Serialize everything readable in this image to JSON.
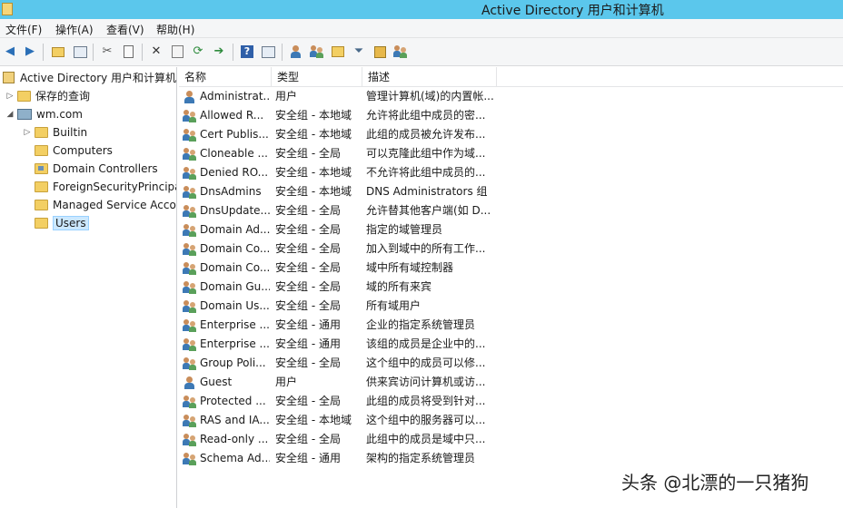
{
  "window": {
    "title": "Active Directory 用户和计算机"
  },
  "menu": [
    "文件(F)",
    "操作(A)",
    "查看(V)",
    "帮助(H)"
  ],
  "toolbar": {
    "icons": [
      "back-arrow-icon",
      "forward-arrow-icon",
      "up-folder-icon",
      "show-tree-icon",
      "cut-icon",
      "copy-icon",
      "delete-icon",
      "properties-icon",
      "refresh-icon",
      "export-list-icon",
      "help-icon",
      "console-icon",
      "new-user-icon",
      "new-group-icon",
      "new-ou-icon",
      "filter-icon",
      "find-icon",
      "add-to-group-icon"
    ]
  },
  "tree": {
    "root": "Active Directory 用户和计算机",
    "saved_queries": "保存的查询",
    "domain": "wm.com",
    "containers": [
      "Builtin",
      "Computers",
      "Domain Controllers",
      "ForeignSecurityPrincipals",
      "Managed Service Accounts",
      "Users"
    ],
    "selected": "Users"
  },
  "list": {
    "columns": {
      "name": "名称",
      "type": "类型",
      "desc": "描述"
    },
    "rows": [
      {
        "name": "Administrat...",
        "type": "用户",
        "desc": "管理计算机(域)的内置帐...",
        "kind": "user"
      },
      {
        "name": "Allowed R...",
        "type": "安全组 - 本地域",
        "desc": "允许将此组中成员的密...",
        "kind": "group"
      },
      {
        "name": "Cert Publis...",
        "type": "安全组 - 本地域",
        "desc": "此组的成员被允许发布...",
        "kind": "group"
      },
      {
        "name": "Cloneable ...",
        "type": "安全组 - 全局",
        "desc": "可以克隆此组中作为域...",
        "kind": "group"
      },
      {
        "name": "Denied RO...",
        "type": "安全组 - 本地域",
        "desc": "不允许将此组中成员的...",
        "kind": "group"
      },
      {
        "name": "DnsAdmins",
        "type": "安全组 - 本地域",
        "desc": "DNS Administrators 组",
        "kind": "group"
      },
      {
        "name": "DnsUpdate...",
        "type": "安全组 - 全局",
        "desc": "允许替其他客户端(如 D...",
        "kind": "group"
      },
      {
        "name": "Domain Ad...",
        "type": "安全组 - 全局",
        "desc": "指定的域管理员",
        "kind": "group"
      },
      {
        "name": "Domain Co...",
        "type": "安全组 - 全局",
        "desc": "加入到域中的所有工作...",
        "kind": "group"
      },
      {
        "name": "Domain Co...",
        "type": "安全组 - 全局",
        "desc": "域中所有域控制器",
        "kind": "group"
      },
      {
        "name": "Domain Gu...",
        "type": "安全组 - 全局",
        "desc": "域的所有来宾",
        "kind": "group"
      },
      {
        "name": "Domain Us...",
        "type": "安全组 - 全局",
        "desc": "所有域用户",
        "kind": "group"
      },
      {
        "name": "Enterprise ...",
        "type": "安全组 - 通用",
        "desc": "企业的指定系统管理员",
        "kind": "group"
      },
      {
        "name": "Enterprise ...",
        "type": "安全组 - 通用",
        "desc": "该组的成员是企业中的...",
        "kind": "group"
      },
      {
        "name": "Group Poli...",
        "type": "安全组 - 全局",
        "desc": "这个组中的成员可以修...",
        "kind": "group"
      },
      {
        "name": "Guest",
        "type": "用户",
        "desc": "供来宾访问计算机或访...",
        "kind": "user"
      },
      {
        "name": "Protected ...",
        "type": "安全组 - 全局",
        "desc": "此组的成员将受到针对...",
        "kind": "group"
      },
      {
        "name": "RAS and IA...",
        "type": "安全组 - 本地域",
        "desc": "这个组中的服务器可以...",
        "kind": "group"
      },
      {
        "name": "Read-only ...",
        "type": "安全组 - 全局",
        "desc": "此组中的成员是域中只...",
        "kind": "group"
      },
      {
        "name": "Schema Ad...",
        "type": "安全组 - 通用",
        "desc": "架构的指定系统管理员",
        "kind": "group"
      }
    ]
  },
  "watermark": "头条 @北漂的一只猪狗"
}
